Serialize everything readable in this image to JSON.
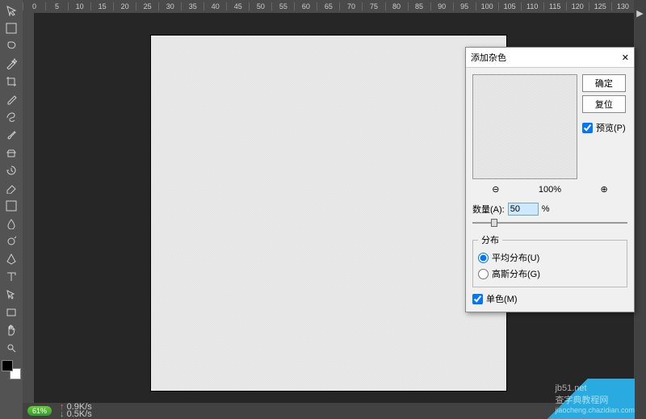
{
  "ruler": {
    "ticks": [
      0,
      5,
      10,
      15,
      20,
      25,
      30,
      35,
      40,
      45,
      50,
      55,
      60,
      65,
      70,
      75,
      80,
      85,
      90,
      95,
      100,
      105,
      110,
      115,
      120,
      125,
      130
    ]
  },
  "tools": [
    {
      "name": "move-tool"
    },
    {
      "name": "marquee-tool"
    },
    {
      "name": "lasso-tool"
    },
    {
      "name": "magic-wand-tool"
    },
    {
      "name": "crop-tool"
    },
    {
      "name": "eyedropper-tool"
    },
    {
      "name": "healing-brush-tool"
    },
    {
      "name": "brush-tool"
    },
    {
      "name": "clone-stamp-tool"
    },
    {
      "name": "history-brush-tool"
    },
    {
      "name": "eraser-tool"
    },
    {
      "name": "gradient-tool"
    },
    {
      "name": "blur-tool"
    },
    {
      "name": "dodge-tool"
    },
    {
      "name": "pen-tool"
    },
    {
      "name": "type-tool"
    },
    {
      "name": "path-selection-tool"
    },
    {
      "name": "rectangle-tool"
    },
    {
      "name": "hand-tool"
    },
    {
      "name": "zoom-tool"
    }
  ],
  "dialog": {
    "title": "添加杂色",
    "ok": "确定",
    "reset": "复位",
    "preview_label": "预览(P)",
    "preview_checked": true,
    "zoom_out": "⊖",
    "zoom_pct": "100%",
    "zoom_in": "⊕",
    "amount_label": "数量(A):",
    "amount_value": "50",
    "amount_unit": "%",
    "distribution_legend": "分布",
    "uniform_label": "平均分布(U)",
    "gaussian_label": "高斯分布(G)",
    "distribution_selected": "uniform",
    "mono_label": "单色(M)",
    "mono_checked": true
  },
  "status": {
    "net_pct": "61%",
    "up": "0.9K/s",
    "down": "0.5K/s"
  },
  "watermark": {
    "text1": "查字典教程网",
    "text2": "jiaocheng.chazidian.com",
    "text3": "jb51.net"
  }
}
